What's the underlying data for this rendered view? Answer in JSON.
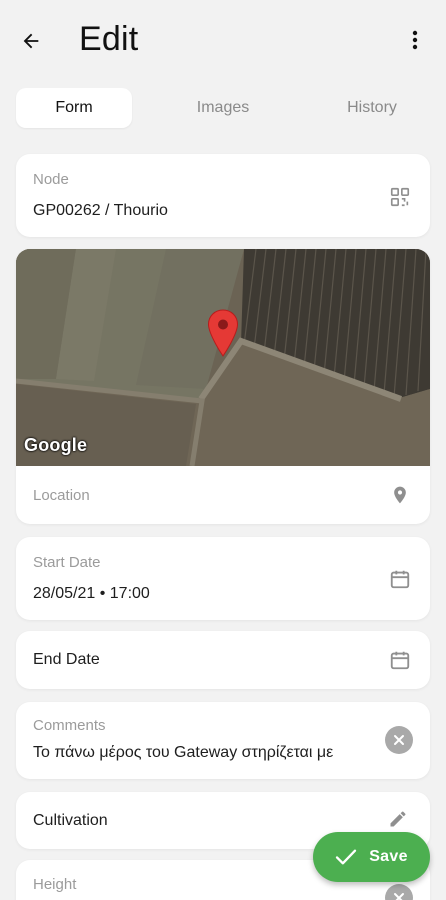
{
  "header": {
    "title": "Edit",
    "back_icon": "arrow-back-icon",
    "menu_icon": "more-vert-icon"
  },
  "tabs": [
    {
      "label": "Form",
      "active": true
    },
    {
      "label": "Images",
      "active": false
    },
    {
      "label": "History",
      "active": false
    }
  ],
  "node": {
    "label": "Node",
    "value": "GP00262 / Thourio",
    "icon": "qr-code-icon"
  },
  "map": {
    "attribution": "Google",
    "marker_icon": "map-pin-icon"
  },
  "location": {
    "label": "Location",
    "icon": "location-pin-icon"
  },
  "start_date": {
    "label": "Start Date",
    "value": "28/05/21 • 17:00",
    "icon": "calendar-icon"
  },
  "end_date": {
    "label": "End Date",
    "icon": "calendar-icon"
  },
  "comments": {
    "label": "Comments",
    "value": "Το πάνω μέρος του Gateway στηρίζεται με",
    "icon": "clear-icon"
  },
  "cultivation": {
    "label": "Cultivation",
    "icon": "edit-pencil-icon"
  },
  "height": {
    "label": "Height",
    "icon": "clear-icon"
  },
  "save": {
    "label": "Save",
    "icon": "check-icon",
    "color": "#4caf50"
  }
}
